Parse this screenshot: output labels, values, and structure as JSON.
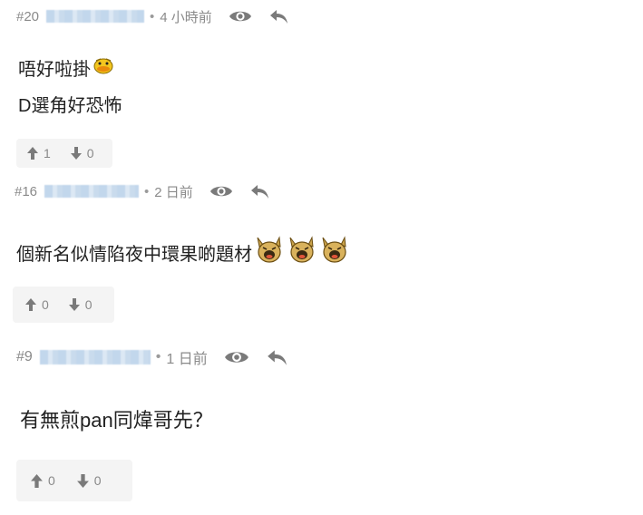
{
  "comments": [
    {
      "number": "#20",
      "username": "EllaPeterson",
      "separator": "•",
      "time": "4 小時前",
      "lines": [
        "唔好啦掛",
        "D選角好恐怖"
      ],
      "upvotes": "1",
      "downvotes": "0",
      "stickers": [
        "duck-sticker"
      ]
    },
    {
      "number": "#16",
      "username": "會員名稱",
      "separator": "•",
      "time": "2 日前",
      "lines": [
        "個新名似情陷夜中環果啲題材"
      ],
      "upvotes": "0",
      "downvotes": "0",
      "stickers": [
        "laughing-dog-sticker",
        "laughing-dog-sticker",
        "laughing-dog-sticker"
      ]
    },
    {
      "number": "#9",
      "username": "the會員名稱大",
      "separator": "•",
      "time": "1 日前",
      "lines": [
        "有無煎pan同煒哥先？"
      ],
      "upvotes": "0",
      "downvotes": "0",
      "stickers": []
    }
  ],
  "colors": {
    "meta_text": "#8a8a8a",
    "body_text": "#222222",
    "vote_bg": "#f4f4f4",
    "icon": "#7a7a7a"
  }
}
